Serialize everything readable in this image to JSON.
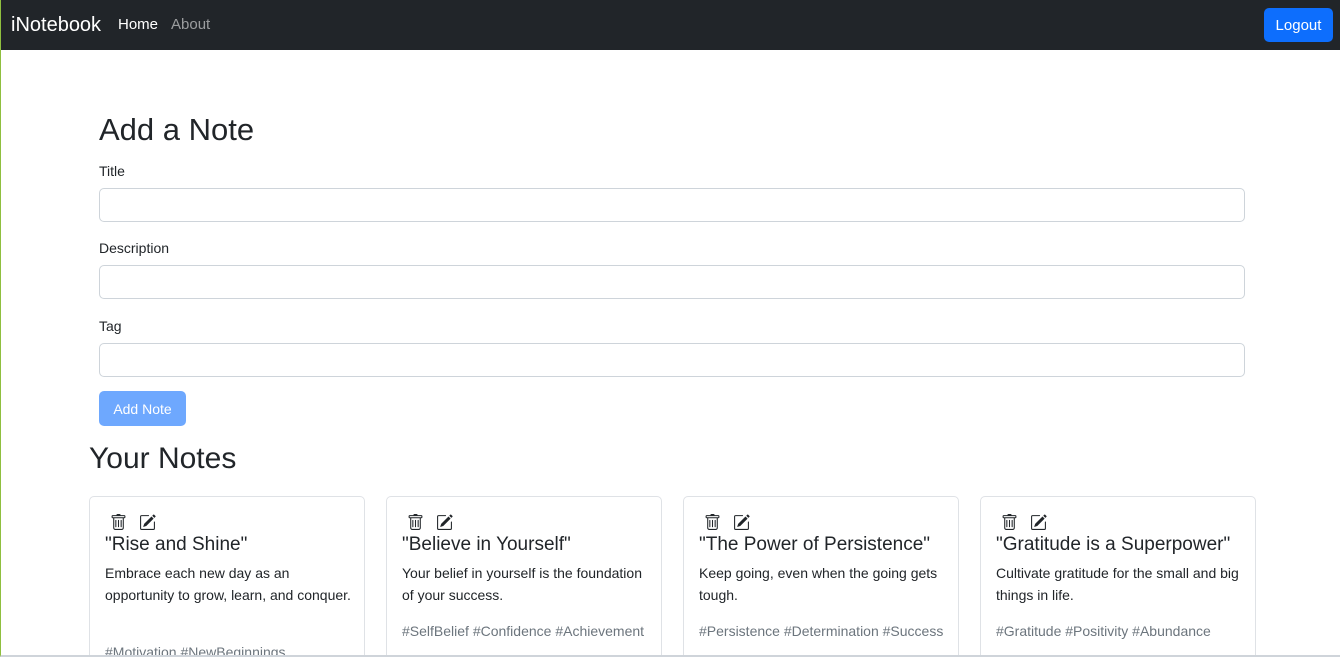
{
  "navbar": {
    "brand": "iNotebook",
    "links": [
      {
        "label": "Home",
        "active": true
      },
      {
        "label": "About",
        "active": false
      }
    ],
    "logout_label": "Logout",
    "logout_color": "#0d6efd"
  },
  "add_note": {
    "heading": "Add a Note",
    "fields": {
      "title": {
        "label": "Title",
        "value": ""
      },
      "description": {
        "label": "Description",
        "value": ""
      },
      "tag": {
        "label": "Tag",
        "value": ""
      }
    },
    "submit_label": "Add Note"
  },
  "notes_section": {
    "heading": "Your Notes",
    "notes": [
      {
        "title": "\"Rise and Shine\"",
        "description": "Embrace each new day as an opportunity to grow, learn, and conquer.",
        "tags": "#Motivation #NewBeginnings"
      },
      {
        "title": "\"Believe in Yourself\"",
        "description": "Your belief in yourself is the foundation of your success.",
        "tags": "#SelfBelief #Confidence #Achievement"
      },
      {
        "title": "\"The Power of Persistence\"",
        "description": "Keep going, even when the going gets tough.",
        "tags": "#Persistence #Determination #Success"
      },
      {
        "title": "\"Gratitude is a Superpower\"",
        "description": "Cultivate gratitude for the small and big things in life.",
        "tags": "#Gratitude #Positivity #Abundance"
      }
    ],
    "icons": {
      "delete": "trash-icon",
      "edit": "edit-icon"
    }
  }
}
